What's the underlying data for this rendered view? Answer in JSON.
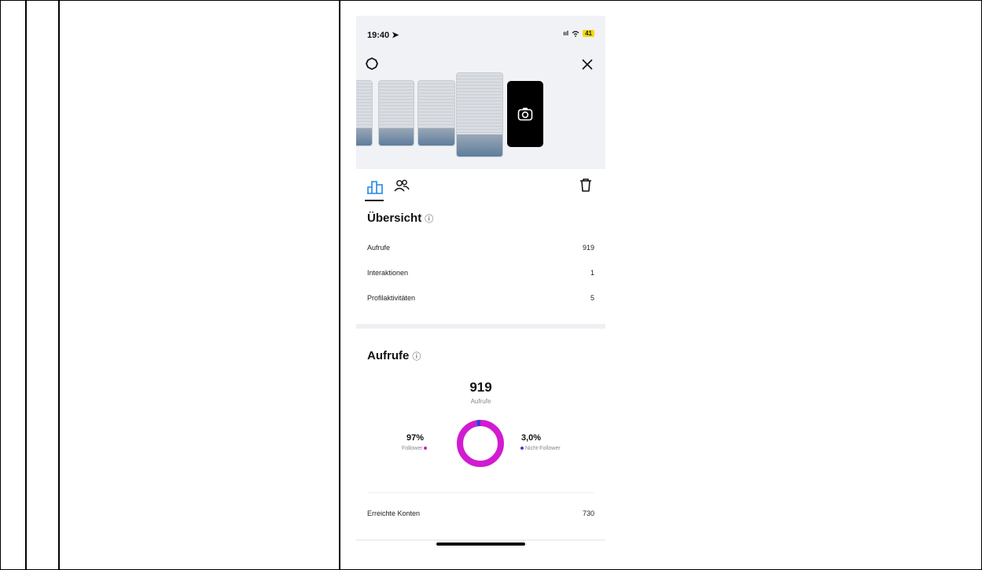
{
  "status_bar": {
    "time": "19:40",
    "signal": "ııl",
    "battery": "41"
  },
  "tabs": [
    {
      "name": "insights-tab"
    },
    {
      "name": "accounts-tab"
    }
  ],
  "overview": {
    "title": "Übersicht",
    "rows": [
      {
        "label": "Aufrufe",
        "value": "919"
      },
      {
        "label": "Interaktionen",
        "value": "1"
      },
      {
        "label": "Profilaktivitäten",
        "value": "5"
      }
    ]
  },
  "views": {
    "title": "Aufrufe",
    "total": "919",
    "total_label": "Aufrufe",
    "followers_pct": "97%",
    "followers_label": "Follower",
    "non_followers_pct": "3,0%",
    "non_followers_label": "Nicht-Follower",
    "followers_fraction": 0.97,
    "colors": {
      "followers": "#d21bd0",
      "non_followers": "#3b3bd6"
    }
  },
  "reach": {
    "label": "Erreichte Konten",
    "value": "730"
  }
}
